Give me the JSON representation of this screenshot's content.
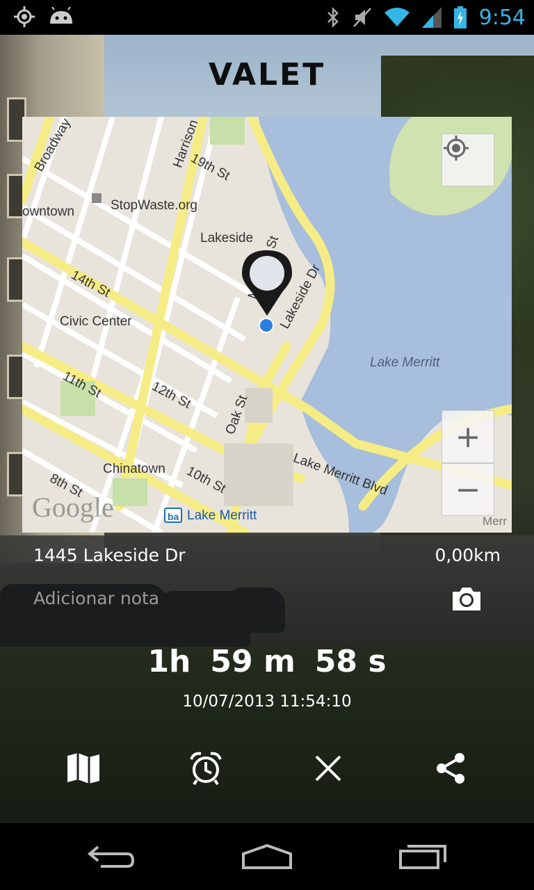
{
  "status_bar": {
    "time": "9:54",
    "icons": [
      "location-icon",
      "android-icon",
      "bluetooth-icon",
      "mute-icon",
      "wifi-icon",
      "signal-icon",
      "battery-icon"
    ],
    "time_color": "#33b5e5"
  },
  "app": {
    "title": "VALET"
  },
  "map": {
    "labels": {
      "broadway": "Broadway",
      "harrison": "Harrison",
      "st19": "19th St",
      "downtown": "owntown",
      "stopwaste": "StopWaste.org",
      "lakeside": "Lakeside",
      "madison": "Madison St",
      "lakeside_dr": "Lakeside Dr",
      "st14": "14th St",
      "civic": "Civic Center",
      "lake_merritt": "Lake Merritt",
      "st11": "11th St",
      "st12": "12th St",
      "oak": "Oak St",
      "chinatown": "Chinatown",
      "st10": "10th St",
      "st8": "8th St",
      "lm_blvd": "Lake Merritt Blvd",
      "merr": "Merr",
      "google": "Google",
      "bart": "Lake Merritt"
    },
    "zoom_in": "+",
    "zoom_out": "−"
  },
  "parking": {
    "address": "1445 Lakeside Dr",
    "distance": "0,00km",
    "note_placeholder": "Adicionar nota",
    "timer": {
      "hours": "1h",
      "minutes": "59 m",
      "seconds": "58 s"
    },
    "datetime": "10/07/2013 11:54:10"
  },
  "actions": [
    "map-icon",
    "alarm-icon",
    "close-icon",
    "share-icon"
  ],
  "nav": [
    "back-icon",
    "home-icon",
    "recent-apps-icon"
  ]
}
